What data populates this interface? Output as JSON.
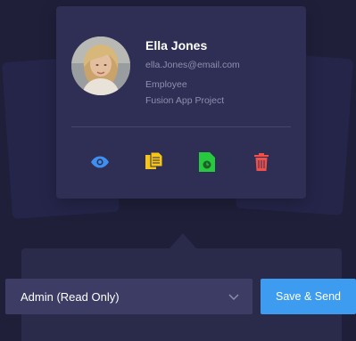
{
  "profile": {
    "name": "Ella Jones",
    "email": "ella.Jones@email.com",
    "role": "Employee",
    "project": "Fusion App Project"
  },
  "actions": [
    {
      "icon": "eye-icon",
      "color": "#3d8ff0"
    },
    {
      "icon": "documents-icon",
      "color": "#f5c518"
    },
    {
      "icon": "file-clock-icon",
      "color": "#27c93f"
    },
    {
      "icon": "trash-icon",
      "color": "#f0504a"
    }
  ],
  "access": {
    "selected": "Admin (Read Only)"
  },
  "send_button": {
    "label": "Save & Send"
  },
  "colors": {
    "background": "#1f1f3a",
    "card": "#2f2f55",
    "accent": "#3d9bf0"
  }
}
